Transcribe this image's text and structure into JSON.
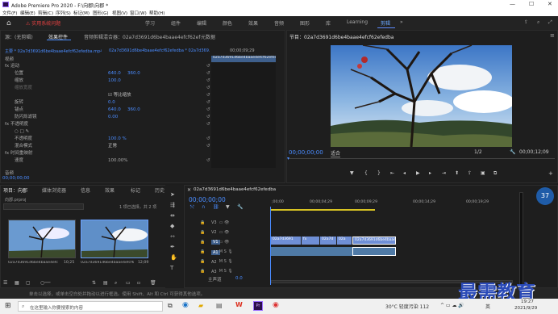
{
  "window": {
    "title": "Adobe Premiere Pro 2020 - F:\\向郡\\向郡 *",
    "min": "—",
    "max": "☐",
    "close": "✕"
  },
  "menu": [
    "文件(F)",
    "编辑(E)",
    "剪辑(C)",
    "序列(S)",
    "标记(M)",
    "图形(G)",
    "视图(V)",
    "窗口(W)",
    "帮助(H)"
  ],
  "workspace": {
    "warning": "⚠ 实用系统问题",
    "tabs": [
      "学习",
      "组件",
      "编辑",
      "颜色",
      "效果",
      "音频",
      "图形",
      "库",
      "Learning",
      "剪辑"
    ],
    "active": "剪辑"
  },
  "effect_controls": {
    "tabs": [
      "源：(无剪辑)",
      "效果控件",
      "音频剪辑混合器：02a7d3691d6be4baae4efcf62efedba",
      "元数据"
    ],
    "header_left": "主要 * 02a7d3691d6be4baae4efcf62efedba.mp4",
    "header_right": "02a7d3691d6be4baae4efcf62efedba * 02a7d369...",
    "time_ruler": "00;00;09;29",
    "clip_label": "02a7d3691d6be4baae4efcf62efedba",
    "section_video": "视频",
    "rows": [
      {
        "label": "fx 运动",
        "v1": "",
        "v2": ""
      },
      {
        "label": "位置",
        "v1": "640.0",
        "v2": "360.0"
      },
      {
        "label": "缩放",
        "v1": "100.0",
        "v2": ""
      },
      {
        "label": "缩放宽度",
        "v1": "",
        "v2": ""
      },
      {
        "label": "",
        "v1": "☑ 等比缩放",
        "v2": ""
      },
      {
        "label": "旋转",
        "v1": "0.0",
        "v2": ""
      },
      {
        "label": "锚点",
        "v1": "640.0",
        "v2": "360.0"
      },
      {
        "label": "防闪烁滤镜",
        "v1": "0.00",
        "v2": ""
      },
      {
        "label": "fx 不透明度",
        "v1": "",
        "v2": ""
      },
      {
        "label": "○ □ ✎",
        "v1": "",
        "v2": ""
      },
      {
        "label": "不透明度",
        "v1": "100.0 %",
        "v2": ""
      },
      {
        "label": "混合模式",
        "v1": "正常",
        "v2": ""
      },
      {
        "label": "fx 时间重映射",
        "v1": "",
        "v2": ""
      },
      {
        "label": "速度",
        "v1": "100.00%",
        "v2": ""
      }
    ],
    "section_audio": "音频",
    "footer_time": "00;00;00;00"
  },
  "program": {
    "title": "节目：02a7d3691d6be4baae4efcf62efedba",
    "timecode": "00;00;00;00",
    "fit": "适合",
    "ratio": "1/2",
    "duration": "00;00;12;09"
  },
  "project": {
    "tabs": [
      "项目：向郡",
      "媒体浏览器",
      "信息",
      "效果",
      "标记",
      "历史"
    ],
    "path": "向郡.prproj",
    "count": "1 项已选择，共 2 项",
    "items": [
      {
        "name": "02a7d3691d6be4baae4efcf62e...",
        "dur": "10;25"
      },
      {
        "name": "02a7d3691d6be4baae4efcf62...",
        "dur": "12;09"
      }
    ]
  },
  "timeline": {
    "title": "02a7d3691d6be4baae4efcf62efedba",
    "timecode": "00;00;00;00",
    "ruler": [
      ";00;00",
      "00;00;04;29",
      "00;00;09;29",
      "00;00;14;29",
      "00;00;19;29"
    ],
    "tracks": [
      "V3",
      "V2",
      "V1",
      "A1",
      "A2",
      "A3"
    ],
    "master": "主声道",
    "master_val": "0.0",
    "clips": [
      "02a7d3691",
      "02a7d",
      "02a",
      "02a7d3691d6be4baae"
    ]
  },
  "status": {
    "text": "单击以选择，或单击空白处并拖动以进行框选。使用 Shift、Alt 和 Ctrl 可获得其他选项。"
  },
  "taskbar": {
    "search": "在这里输入你要搜索的内容",
    "weather": "30°C 轻度污染 112",
    "lang": "英",
    "time": "19:27",
    "date": "2021/9/29"
  },
  "watermark": "最需教育",
  "volume_badge": "37"
}
